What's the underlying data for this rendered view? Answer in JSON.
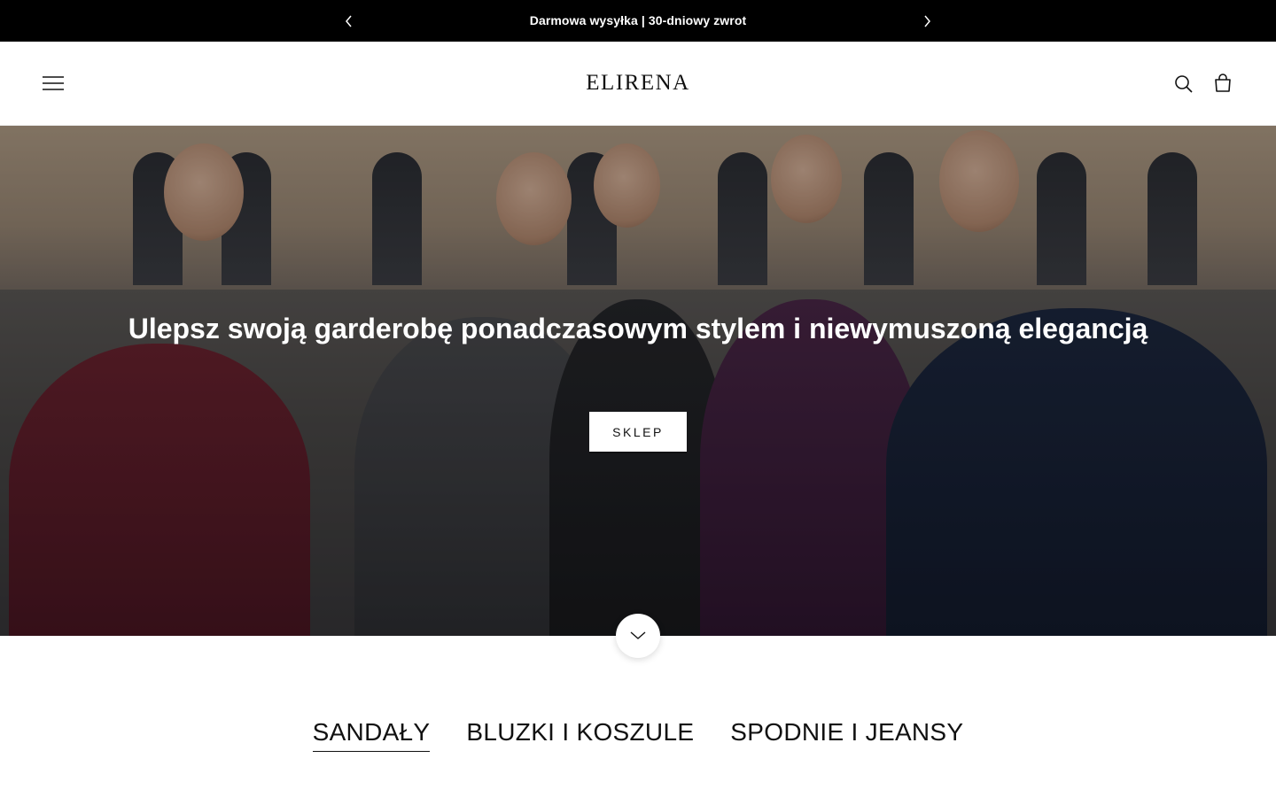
{
  "announcement": {
    "text": "Darmowa wysyłka | 30-dniowy zwrot",
    "prev_icon": "chevron-left-icon",
    "next_icon": "chevron-right-icon"
  },
  "header": {
    "logo": "ELIRENA",
    "menu_icon": "hamburger-menu-icon",
    "search_icon": "search-icon",
    "cart_icon": "shopping-bag-icon"
  },
  "hero": {
    "title": "Ulepsz swoją garderobę ponadczasowym stylem i niewymuszoną elegancją",
    "button_label": "SKLEP",
    "scroll_icon": "chevron-down-icon"
  },
  "categories": {
    "tabs": [
      {
        "label": "SANDAŁY",
        "active": true
      },
      {
        "label": "BLUZKI I KOSZULE",
        "active": false
      },
      {
        "label": "SPODNIE I JEANSY",
        "active": false
      }
    ]
  },
  "colors": {
    "announcement_bg": "#000000",
    "text": "#111111",
    "button_bg": "#ffffff"
  }
}
